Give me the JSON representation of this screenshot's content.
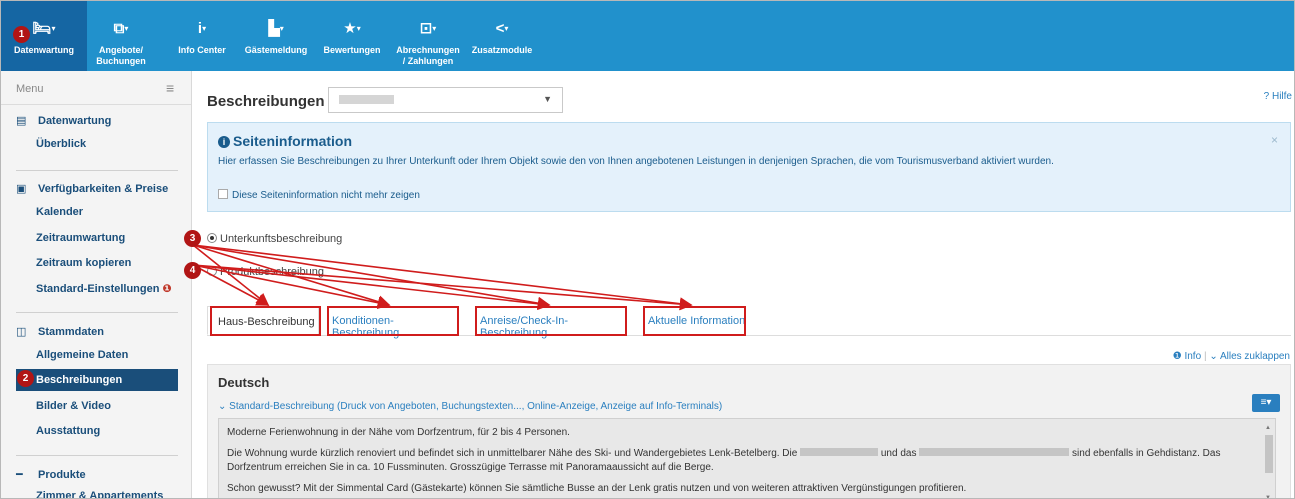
{
  "nav": {
    "items": [
      {
        "icon": "bed-icon",
        "glyph": "🛏",
        "lines": [
          "Datenwartung"
        ],
        "active": true
      },
      {
        "icon": "offers-icon",
        "glyph": "⧉",
        "lines": [
          "Angebote/",
          "Buchungen"
        ],
        "active": false
      },
      {
        "icon": "info-icon",
        "glyph": "i",
        "lines": [
          "Info Center"
        ],
        "active": false
      },
      {
        "icon": "guest-report-icon",
        "glyph": "▙",
        "lines": [
          "Gästemeldung"
        ],
        "active": false
      },
      {
        "icon": "star-icon",
        "glyph": "★",
        "lines": [
          "Bewertungen"
        ],
        "active": false
      },
      {
        "icon": "billing-icon",
        "glyph": "⊡",
        "lines": [
          "Abrechnungen",
          "/ Zahlungen"
        ],
        "active": false
      },
      {
        "icon": "share-icon",
        "glyph": "<",
        "lines": [
          "Zusatzmodule"
        ],
        "active": false
      }
    ]
  },
  "sidebar": {
    "menu_label": "Menu",
    "sections": [
      {
        "title": "Datenwartung",
        "icon": "document-icon",
        "glyph": "▤",
        "items": [
          "Überblick"
        ]
      },
      {
        "title": "Verfügbarkeiten & Preise",
        "icon": "money-icon",
        "glyph": "▣",
        "items": [
          "Kalender",
          "Zeitraumwartung",
          "Zeitraum kopieren",
          "Standard-Einstellungen"
        ]
      },
      {
        "title": "Stammdaten",
        "icon": "columns-icon",
        "glyph": "◫",
        "items": [
          "Allgemeine Daten",
          "Beschreibungen",
          "Bilder & Video",
          "Ausstattung"
        ]
      },
      {
        "title": "Produkte",
        "icon": "bed-icon",
        "glyph": "━",
        "items": [
          "Zimmer & Appartements"
        ]
      }
    ],
    "warn_glyph": "❶",
    "active_item": "Beschreibungen"
  },
  "main": {
    "title": "Beschreibungen",
    "help": "? Hilfe",
    "info": {
      "heading": "Seiteninformation",
      "text": "Hier erfassen Sie Beschreibungen zu Ihrer Unterkunft oder Ihrem Objekt sowie den von Ihnen angebotenen Leistungen in denjenigen Sprachen, die vom Tourismusverband aktiviert wurden.",
      "checkbox": "Diese Seiteninformation nicht mehr zeigen",
      "close": "×"
    },
    "radios": [
      {
        "label": "Unterkunftsbeschreibung",
        "checked": true
      },
      {
        "label": "Produktbeschreibung",
        "checked": false
      }
    ],
    "tabs": [
      "Haus-Beschreibung",
      "Konditionen-Beschreibung",
      "Anreise/Check-In-Beschreibung",
      "Aktuelle Information"
    ],
    "meta": {
      "info": "Info",
      "sep": "|",
      "collapse": "Alles zuklappen"
    },
    "panel": {
      "language": "Deutsch",
      "collapsible": "Standard-Beschreibung (Druck von Angeboten, Buchungstexten..., Online-Anzeige, Anzeige auf Info-Terminals)",
      "lines": [
        "Moderne Ferienwohnung in der Nähe vom Dorfzentrum, für 2 bis 4 Personen.",
        "Die Wohnung wurde kürzlich renoviert und befindet sich in unmittelbarer Nähe des Ski- und Wandergebietes Lenk-Betelberg. Die",
        "und das",
        "sind ebenfalls in Gehdistanz. Das",
        "Dorfzentrum erreichen Sie in ca. 10 Fussminuten. Grosszügige Terrasse mit Panoramaaussicht auf die Berge.",
        "Schon gewusst? Mit der Simmental Card (Gästekarte) können Sie sämtliche Busse an der Lenk gratis nutzen und von weiteren attraktiven Vergünstigungen profitieren."
      ]
    }
  },
  "annotations": [
    "1",
    "2",
    "3",
    "4"
  ],
  "colors": {
    "nav": "#2191cc",
    "nav_active": "#1566a3",
    "accent": "#1a4e7a",
    "annotation": "#d01c1c"
  }
}
